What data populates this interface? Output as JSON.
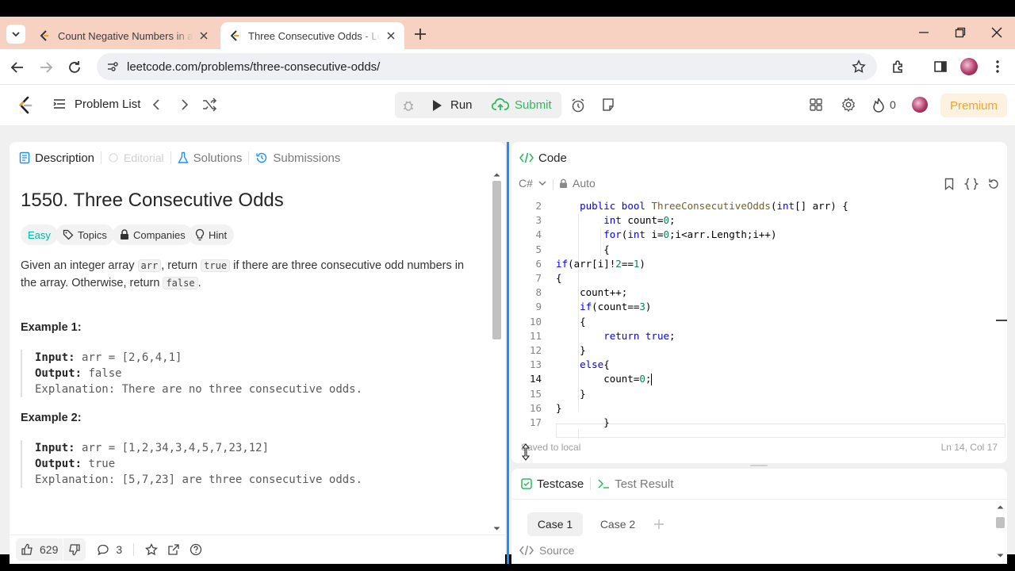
{
  "browser": {
    "tabs": [
      {
        "title": "Count Negative Numbers in a S",
        "active": false
      },
      {
        "title": "Three Consecutive Odds - LeetCode",
        "active": true
      }
    ],
    "url": "leetcode.com/problems/three-consecutive-odds/"
  },
  "nav": {
    "problem_list": "Problem List",
    "run": "Run",
    "submit": "Submit",
    "streak": "0",
    "premium": "Premium"
  },
  "left": {
    "tabs": [
      "Description",
      "Editorial",
      "Solutions",
      "Submissions"
    ],
    "title": "1550. Three Consecutive Odds",
    "tags": [
      "Easy",
      "Topics",
      "Companies",
      "Hint"
    ],
    "desc": {
      "p1": "Given an integer array ",
      "c1": "arr",
      "p2": ", return ",
      "c2": "true",
      "p3": " if there are three consecutive odd numbers in the array. Otherwise, return ",
      "c3": "false",
      "p4": "."
    },
    "examples": [
      {
        "heading": "Example 1:",
        "input_label": "Input:",
        "input": "arr = [2,6,4,1]",
        "output_label": "Output:",
        "output": "false",
        "expl_label": "Explanation:",
        "expl": "There are no three consecutive odds."
      },
      {
        "heading": "Example 2:",
        "input_label": "Input:",
        "input": "arr = [1,2,34,3,4,5,7,23,12]",
        "output_label": "Output:",
        "output": "true",
        "expl_label": "Explanation:",
        "expl": "[5,7,23] are three consecutive odds."
      }
    ],
    "footer": {
      "likes": "629",
      "comments": "3"
    }
  },
  "code": {
    "tab": "Code",
    "language": "C#",
    "mode": "Auto",
    "status": "Saved to local",
    "cursor": "Ln 14, Col 17",
    "active_line": 14,
    "lines": [
      {
        "n": "2",
        "text": "    public bool ThreeConsecutiveOdds(int[] arr) {"
      },
      {
        "n": "3",
        "text": "        int count=0;"
      },
      {
        "n": "4",
        "text": "        for(int i=0;i<arr.Length;i++)"
      },
      {
        "n": "5",
        "text": "        {"
      },
      {
        "n": "6",
        "text": "if(arr[i]!2==1)"
      },
      {
        "n": "7",
        "text": "{"
      },
      {
        "n": "8",
        "text": "    count++;"
      },
      {
        "n": "9",
        "text": "    if(count==3)"
      },
      {
        "n": "10",
        "text": "    {"
      },
      {
        "n": "11",
        "text": "        return true;"
      },
      {
        "n": "12",
        "text": "    }"
      },
      {
        "n": "13",
        "text": "    else{"
      },
      {
        "n": "14",
        "text": "        count=0;"
      },
      {
        "n": "15",
        "text": "    }"
      },
      {
        "n": "16",
        "text": "}"
      },
      {
        "n": "17",
        "text": "        }"
      }
    ]
  },
  "test": {
    "tabs": [
      "Testcase",
      "Test Result"
    ],
    "cases": [
      "Case 1",
      "Case 2"
    ],
    "source": "Source"
  },
  "colors": {
    "accent": "#1a90ff",
    "submit": "#2cbb5d",
    "premium": "#f5a524",
    "easy": "#00b8a3"
  }
}
